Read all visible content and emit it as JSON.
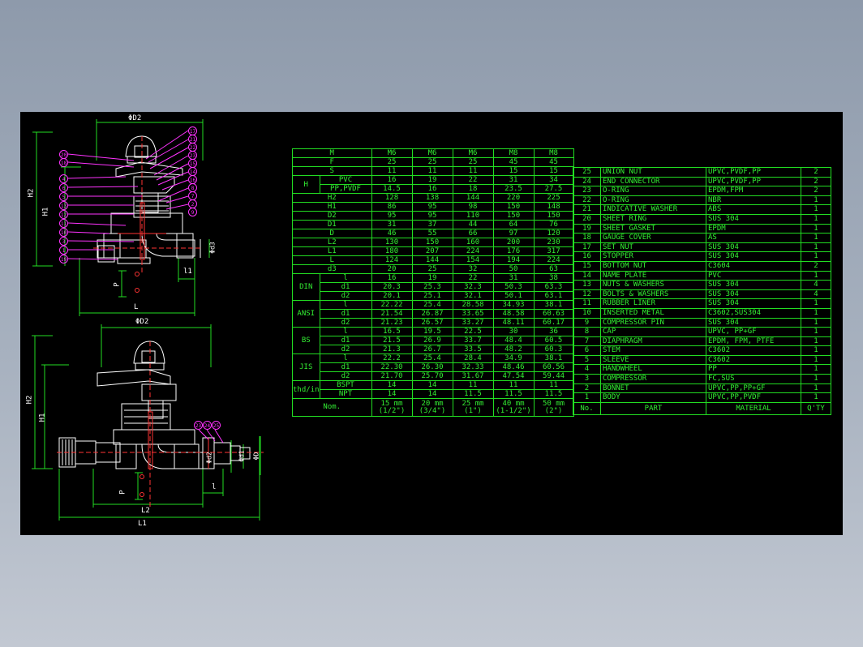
{
  "drawing": {
    "colors": {
      "background": "#000000",
      "lines": "#ffffff",
      "dimension": "#00ff00",
      "balloon": "#ff33ff",
      "centerline": "#ff3333",
      "table": "#22dd22"
    },
    "top_view": {
      "dims": {
        "d2": "ΦD2",
        "h2": "H2",
        "h1": "H1",
        "d3": "Φd3",
        "l1": "l1",
        "p": "P",
        "l": "L"
      },
      "left_balloons": [
        "20",
        "18",
        "4",
        "6",
        "5",
        "13",
        "12",
        "11",
        "10",
        "3",
        "1",
        "19"
      ],
      "right_balloons": [
        "17",
        "21",
        "22",
        "23",
        "15",
        "14",
        "16",
        "8",
        "7",
        "2",
        "9"
      ]
    },
    "bottom_view": {
      "dims": {
        "d2": "ΦD2",
        "h2": "H2",
        "h1": "H1",
        "d1": "Φd1",
        "d2s": "Φd2",
        "d": "ΦD",
        "l": "l",
        "p": "P",
        "l2": "L2",
        "l1": "L1"
      },
      "balloons": [
        "23",
        "24",
        "25"
      ]
    }
  },
  "dimension_table": {
    "sizes": [
      {
        "nom": "15 mm\n(1/2\")"
      },
      {
        "nom": "20 mm\n(3/4\")"
      },
      {
        "nom": "25 mm\n(1\")"
      },
      {
        "nom": "40 mm\n(1-1/2\")"
      },
      {
        "nom": "50 mm\n(2\")"
      }
    ],
    "rows": [
      {
        "label": "M",
        "values": [
          "M6",
          "M6",
          "M6",
          "M8",
          "M8"
        ]
      },
      {
        "label": "F",
        "values": [
          "25",
          "25",
          "25",
          "45",
          "45"
        ]
      },
      {
        "label": "S",
        "values": [
          "11",
          "11",
          "11",
          "15",
          "15"
        ]
      },
      {
        "group": "H",
        "label": "PVC",
        "values": [
          "16",
          "19",
          "22",
          "31",
          "34"
        ]
      },
      {
        "group": "H",
        "label": "PP,PVDF",
        "values": [
          "14.5",
          "16",
          "18",
          "23.5",
          "27.5"
        ]
      },
      {
        "label": "H2",
        "values": [
          "128",
          "138",
          "144",
          "220",
          "225"
        ]
      },
      {
        "label": "H1",
        "values": [
          "86",
          "95",
          "98",
          "150",
          "148"
        ]
      },
      {
        "label": "D2",
        "values": [
          "95",
          "95",
          "110",
          "150",
          "150"
        ]
      },
      {
        "label": "D1",
        "values": [
          "31",
          "37",
          "44",
          "64",
          "76"
        ]
      },
      {
        "label": "D",
        "values": [
          "46",
          "55",
          "66",
          "97",
          "120"
        ]
      },
      {
        "label": "L2",
        "values": [
          "130",
          "150",
          "160",
          "200",
          "230"
        ]
      },
      {
        "label": "L1",
        "values": [
          "180",
          "207",
          "224",
          "176",
          "317"
        ]
      },
      {
        "label": "L",
        "values": [
          "124",
          "144",
          "154",
          "194",
          "224"
        ]
      },
      {
        "label": "d3",
        "values": [
          "20",
          "25",
          "32",
          "50",
          "63"
        ]
      },
      {
        "group": "DIN",
        "label": "l",
        "values": [
          "16",
          "19",
          "22",
          "31",
          "38"
        ]
      },
      {
        "group": "DIN",
        "label": "d1",
        "values": [
          "20.3",
          "25.3",
          "32.3",
          "50.3",
          "63.3"
        ]
      },
      {
        "group": "DIN",
        "label": "d2",
        "values": [
          "20.1",
          "25.1",
          "32.1",
          "50.1",
          "63.1"
        ]
      },
      {
        "group": "ANSI",
        "label": "l",
        "values": [
          "22.22",
          "25.4",
          "28.58",
          "34.93",
          "38.1"
        ]
      },
      {
        "group": "ANSI",
        "label": "d1",
        "values": [
          "21.54",
          "26.87",
          "33.65",
          "48.58",
          "60.63"
        ]
      },
      {
        "group": "ANSI",
        "label": "d2",
        "values": [
          "21.23",
          "26.57",
          "33.27",
          "48.11",
          "60.17"
        ]
      },
      {
        "group": "BS",
        "label": "l",
        "values": [
          "16.5",
          "19.5",
          "22.5",
          "30",
          "36"
        ]
      },
      {
        "group": "BS",
        "label": "d1",
        "values": [
          "21.5",
          "26.9",
          "33.7",
          "48.4",
          "60.5"
        ]
      },
      {
        "group": "BS",
        "label": "d2",
        "values": [
          "21.3",
          "26.7",
          "33.5",
          "48.2",
          "60.3"
        ]
      },
      {
        "group": "JIS",
        "label": "l",
        "values": [
          "22.2",
          "25.4",
          "28.4",
          "34.9",
          "38.1"
        ]
      },
      {
        "group": "JIS",
        "label": "d1",
        "values": [
          "22.30",
          "26.30",
          "32.33",
          "48.46",
          "60.56"
        ]
      },
      {
        "group": "JIS",
        "label": "d2",
        "values": [
          "21.70",
          "25.70",
          "31.67",
          "47.54",
          "59.44"
        ]
      },
      {
        "group": "thd/in",
        "label": "BSPT",
        "values": [
          "14",
          "14",
          "11",
          "11",
          "11"
        ]
      },
      {
        "group": "thd/in",
        "label": "NPT",
        "values": [
          "14",
          "14",
          "11.5",
          "11.5",
          "11.5"
        ]
      }
    ],
    "nom_label": "Nom."
  },
  "parts_list": {
    "header": {
      "no": "No.",
      "part": "PART",
      "material": "MATERIAL",
      "qty": "Q'TY"
    },
    "items": [
      {
        "no": "25",
        "part": "UNION NUT",
        "material": "UPVC,PVDF,PP",
        "qty": "2"
      },
      {
        "no": "24",
        "part": "END CONNECTOR",
        "material": "UPVC,PVDF,PP",
        "qty": "2"
      },
      {
        "no": "23",
        "part": "O-RING",
        "material": "EPDM,FPM",
        "qty": "2"
      },
      {
        "no": "22",
        "part": "O-RING",
        "material": "NBR",
        "qty": "1"
      },
      {
        "no": "21",
        "part": "INDICATIVE WASHER",
        "material": "ABS",
        "qty": "1"
      },
      {
        "no": "20",
        "part": "SHEET RING",
        "material": "SUS 304",
        "qty": "1"
      },
      {
        "no": "19",
        "part": "SHEET GASKET",
        "material": "EPDM",
        "qty": "1"
      },
      {
        "no": "18",
        "part": "GAUGE COVER",
        "material": "AS",
        "qty": "1"
      },
      {
        "no": "17",
        "part": "SET NUT",
        "material": "SUS 304",
        "qty": "1"
      },
      {
        "no": "16",
        "part": "STOPPER",
        "material": "SUS 304",
        "qty": "1"
      },
      {
        "no": "15",
        "part": "BOTTOM NUT",
        "material": "C3604",
        "qty": "2"
      },
      {
        "no": "14",
        "part": "NAME PLATE",
        "material": "PVC",
        "qty": "1"
      },
      {
        "no": "13",
        "part": "NUTS & WASHERS",
        "material": "SUS 304",
        "qty": "4"
      },
      {
        "no": "12",
        "part": "BOLTS & WASHERS",
        "material": "SUS 304",
        "qty": "4"
      },
      {
        "no": "11",
        "part": "RUBBER LINER",
        "material": "SUS 304",
        "qty": "1"
      },
      {
        "no": "10",
        "part": "INSERTED METAL",
        "material": "C3602,SUS304",
        "qty": "1"
      },
      {
        "no": "9",
        "part": "COMPRESSOR PIN",
        "material": "SUS 304",
        "qty": "1"
      },
      {
        "no": "8",
        "part": "CAP",
        "material": "UPVC, PP+GF",
        "qty": "1"
      },
      {
        "no": "7",
        "part": "DIAPHRAGM",
        "material": "EPDM, FPM, PTFE",
        "qty": "1"
      },
      {
        "no": "6",
        "part": "STEM",
        "material": "C3602",
        "qty": "1"
      },
      {
        "no": "5",
        "part": "SLEEVE",
        "material": "C3602",
        "qty": "1"
      },
      {
        "no": "4",
        "part": "HANDWHEEL",
        "material": "PP",
        "qty": "1"
      },
      {
        "no": "3",
        "part": "COMPRESSOR",
        "material": "FC,SUS",
        "qty": "1"
      },
      {
        "no": "2",
        "part": "BONNET",
        "material": "UPVC,PP,PP+GF",
        "qty": "1"
      },
      {
        "no": "1",
        "part": "BODY",
        "material": "UPVC,PP,PVDF",
        "qty": "1"
      }
    ]
  }
}
